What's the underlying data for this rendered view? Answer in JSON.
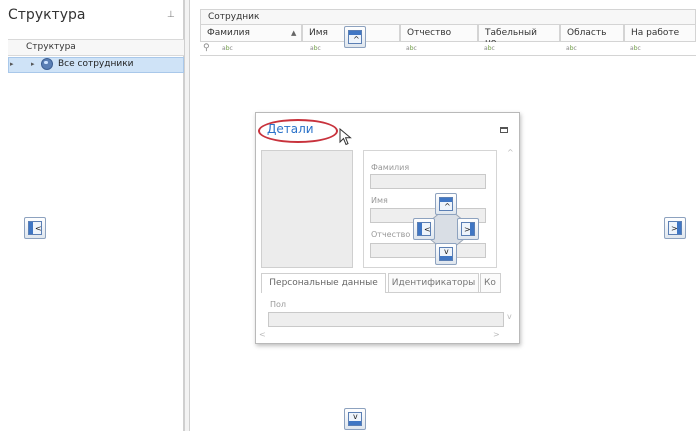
{
  "left_panel": {
    "title": "Структура",
    "pin_glyph": "⊥",
    "tree_header": "Структура",
    "tree_row": {
      "label": "Все сотрудники",
      "row_glyph": "▸",
      "expand_glyph": "▸",
      "icon": "globe-icon"
    }
  },
  "grid": {
    "band": "Сотрудник",
    "columns": [
      {
        "label": "Фамилия",
        "sorted": "asc"
      },
      {
        "label": "Имя"
      },
      {
        "label": "Отчество"
      },
      {
        "label": "Табельный но..."
      },
      {
        "label": "Область"
      },
      {
        "label": "На работе"
      }
    ],
    "filter_glyph": "⚲",
    "sort_glyph": "▲",
    "filter_cell": {
      "a": "a",
      "b": "b",
      "c": "c"
    }
  },
  "details": {
    "title": "Детали",
    "fields": [
      {
        "label": "Фамилия"
      },
      {
        "label": "Имя"
      },
      {
        "label": "Отчество"
      }
    ],
    "tabs": [
      "Персональные данные",
      "Идентификаторы",
      "Ко"
    ],
    "gender_label": "Пол"
  },
  "scroll_glyphs": {
    "up": "^",
    "down": "v",
    "left": "<",
    "right": ">"
  },
  "colors": {
    "accent": "#2a72c9",
    "highlight_ellipse": "#c8323c",
    "selected_row": "#cfe3f7",
    "dock_border": "#8da2bf"
  }
}
